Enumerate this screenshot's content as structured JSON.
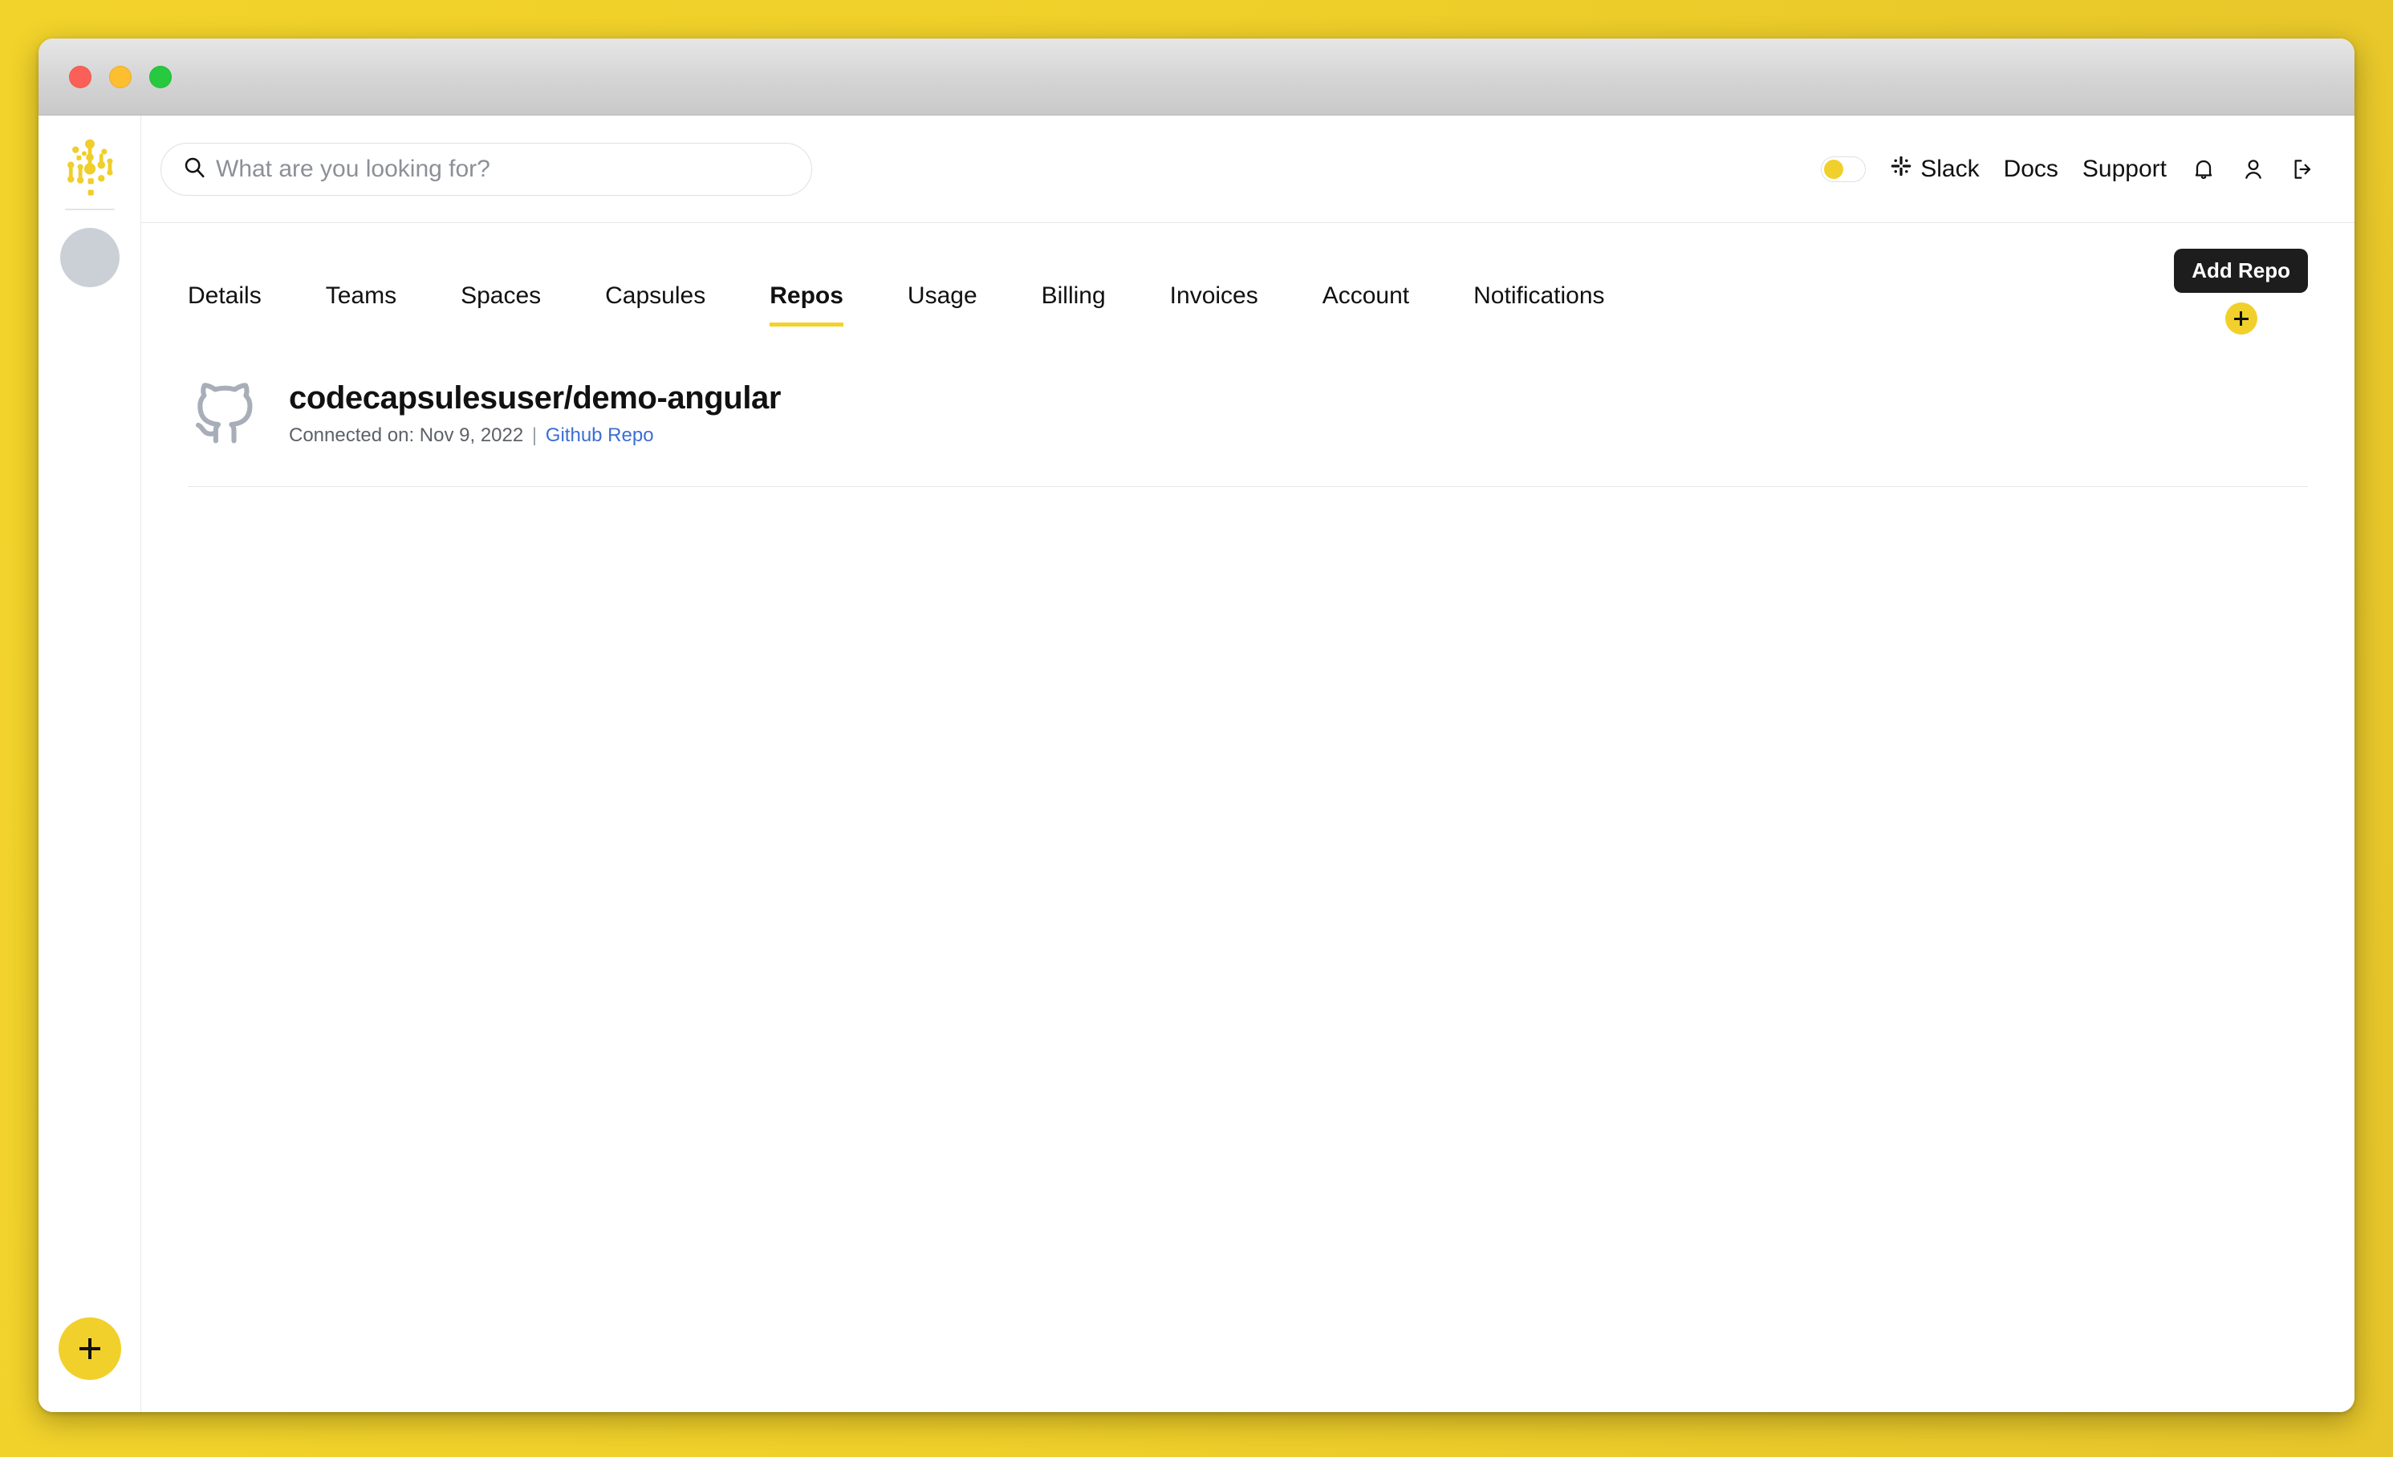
{
  "window": {
    "traffic_lights": [
      "close",
      "minimize",
      "zoom"
    ]
  },
  "sidebar": {
    "logo_name": "code-capsules-logo",
    "avatar_name": "user-avatar",
    "fab_label": "+"
  },
  "header": {
    "search": {
      "placeholder": "What are you looking for?",
      "value": ""
    },
    "theme_toggle": {
      "state": "off",
      "knob_color": "#F2D02B"
    },
    "links": [
      {
        "label": "Slack",
        "icon": "slack-icon"
      },
      {
        "label": "Docs",
        "icon": null
      },
      {
        "label": "Support",
        "icon": null
      }
    ],
    "icons": [
      {
        "name": "notifications-bell-icon"
      },
      {
        "name": "user-account-icon"
      },
      {
        "name": "logout-icon"
      }
    ]
  },
  "tabs": [
    {
      "label": "Details",
      "active": false
    },
    {
      "label": "Teams",
      "active": false
    },
    {
      "label": "Spaces",
      "active": false
    },
    {
      "label": "Capsules",
      "active": false
    },
    {
      "label": "Repos",
      "active": true
    },
    {
      "label": "Usage",
      "active": false
    },
    {
      "label": "Billing",
      "active": false
    },
    {
      "label": "Invoices",
      "active": false
    },
    {
      "label": "Account",
      "active": false
    },
    {
      "label": "Notifications",
      "active": false
    }
  ],
  "add_repo": {
    "tooltip": "Add Repo",
    "button_label": "+"
  },
  "repos": [
    {
      "name": "codecapsulesuser/demo-angular",
      "connected_prefix": "Connected on:",
      "connected_date": "Nov 9, 2022",
      "separator": "|",
      "link_label": "Github Repo",
      "provider_icon": "github-icon"
    }
  ],
  "colors": {
    "brand_yellow": "#F2D32B",
    "accent_yellow": "#F2D02B",
    "link_blue": "#3B6FD4",
    "page_background": "#F0D12C",
    "github_gray": "#A8AEB8"
  }
}
